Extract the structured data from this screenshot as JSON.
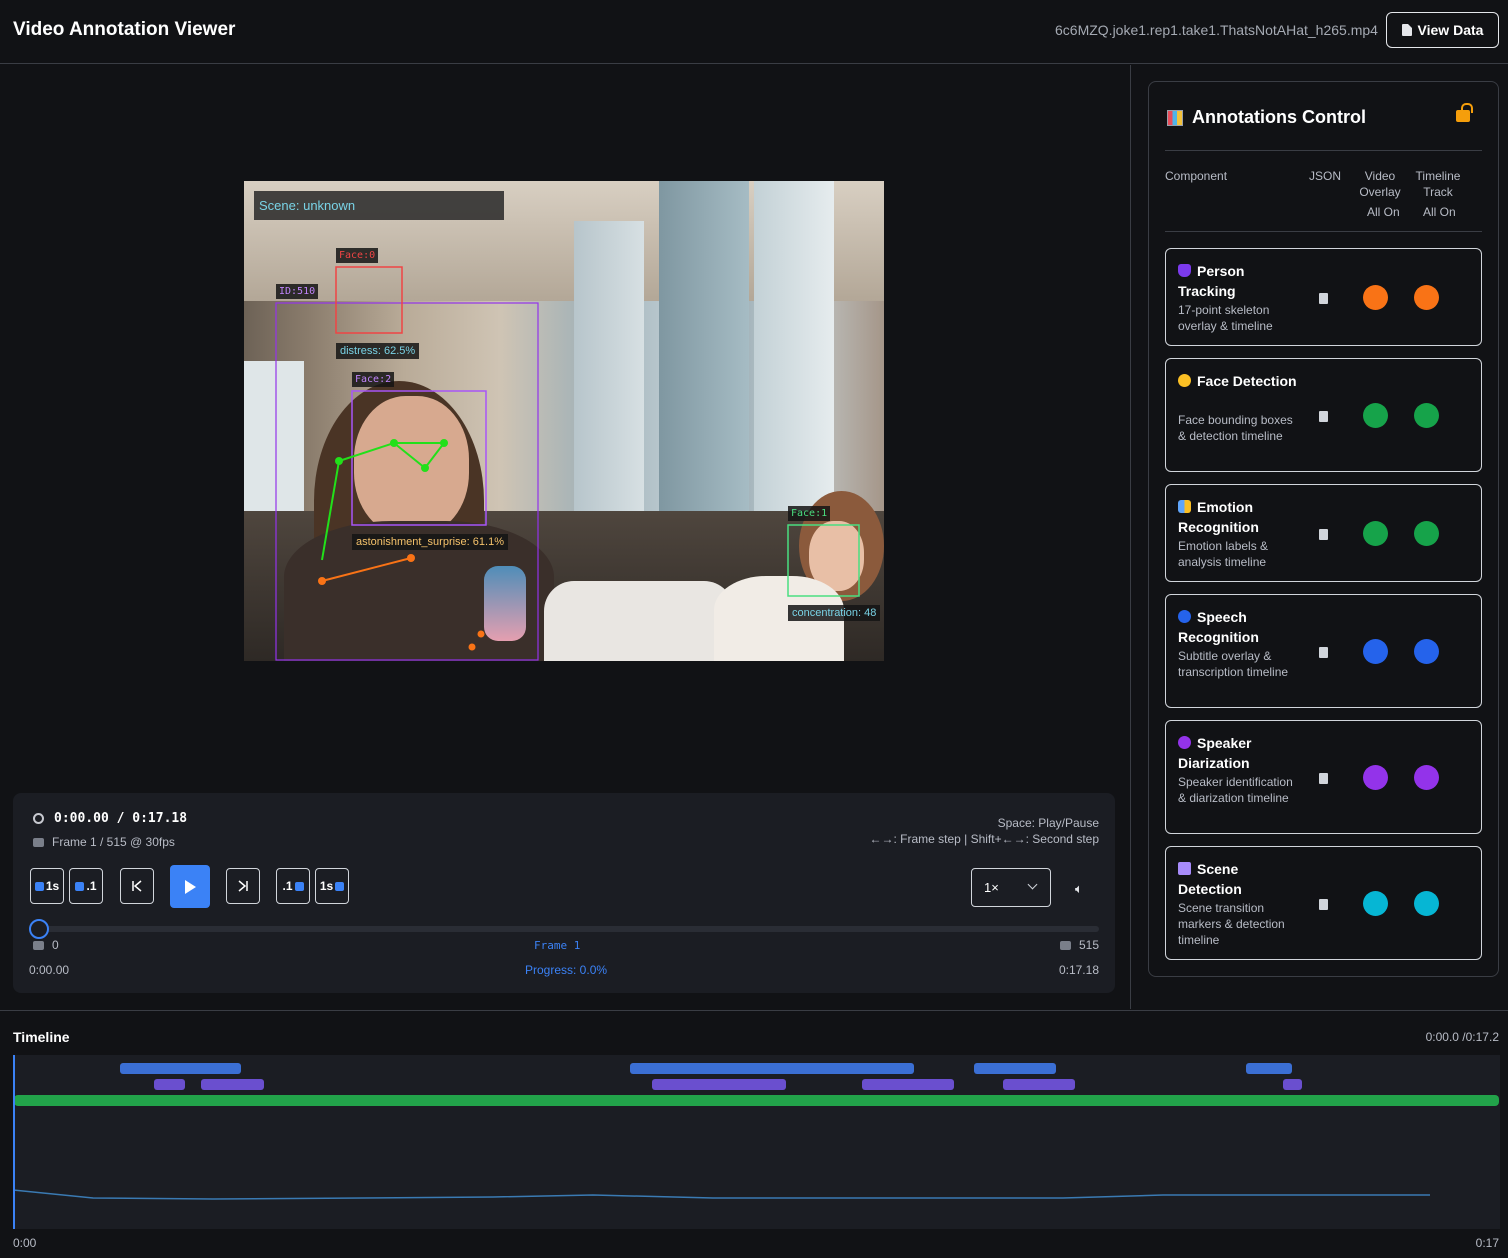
{
  "header": {
    "title": "Video Annotation Viewer",
    "file_name": "6c6MZQ.joke1.rep1.take1.ThatsNotAHat_h265.mp4",
    "view_data_label": "View Data"
  },
  "video": {
    "scene_label": "Scene: unknown",
    "boxes": {
      "face0": "Face:0",
      "id": "ID:510",
      "face2": "Face:2",
      "face1": "Face:1"
    },
    "emotions": {
      "distress": "distress: 62.5%",
      "astonishment": "astonishment_surprise: 61.1%",
      "concentration": "concentration: 48"
    }
  },
  "player": {
    "time": "0:00.00 / 0:17.18",
    "frame_info": "Frame 1 / 515 @ 30fps",
    "shortcut_line1": "Space: Play/Pause",
    "shortcut_line2": "←→: Frame step | Shift+←→: Second step",
    "buttons": {
      "back_1s": "1s",
      "back_01": ".1",
      "fwd_01": ".1",
      "fwd_1s": "1s"
    },
    "speed": "1×",
    "seek_min": "0",
    "seek_frame": "Frame 1",
    "seek_max": "515",
    "time_start": "0:00.00",
    "progress": "Progress: 0.0%",
    "progress_fraction": 0.0,
    "time_end": "0:17.18"
  },
  "panel": {
    "title": "Annotations Control",
    "columns": {
      "component": "Component",
      "json": "JSON",
      "video_overlay": "Video Overlay",
      "timeline_track": "Timeline Track",
      "all_on_1": "All On",
      "all_on_2": "All On"
    },
    "cards": [
      {
        "title": "Person Tracking",
        "desc": "17-point skeleton overlay & timeline",
        "color": "#f97316",
        "icon": "person-icon"
      },
      {
        "title": "Face Detection",
        "desc": "Face bounding boxes & detection timeline",
        "color": "#16a34a",
        "icon": "smiley-icon"
      },
      {
        "title": "Emotion Recognition",
        "desc": "Emotion labels & analysis timeline",
        "color": "#16a34a",
        "icon": "masks-icon"
      },
      {
        "title": "Speech Recognition",
        "desc": "Subtitle overlay & transcription timeline",
        "color": "#2563eb",
        "icon": "blue-circle-icon"
      },
      {
        "title": "Speaker Diarization",
        "desc": "Speaker identification & diarization timeline",
        "color": "#9333ea",
        "icon": "purple-circle-icon"
      },
      {
        "title": "Scene Detection",
        "desc": "Scene transition markers & detection timeline",
        "color": "#06b6d4",
        "icon": "clapper-icon"
      }
    ]
  },
  "timeline": {
    "title": "Timeline",
    "time": "0:00.0 /0:17.2",
    "start": "0:00",
    "end": "0:17",
    "colors": {
      "speech": "#3b6fd4",
      "speaker": "#6a4fcf",
      "scene": "#22a34a",
      "line": "#3a7ab3"
    }
  }
}
